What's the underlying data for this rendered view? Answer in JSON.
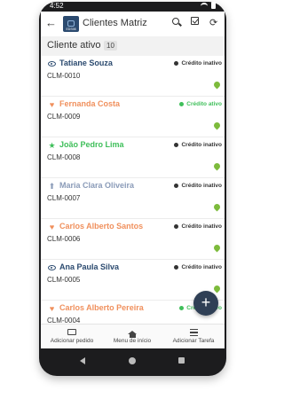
{
  "status_bar": {
    "time": "4:52"
  },
  "app_bar": {
    "logo_text": "EDS98",
    "title": "Clientes Matriz"
  },
  "section": {
    "label": "Cliente ativo",
    "count": "10"
  },
  "clients": [
    {
      "name": "Tatiane Souza",
      "code": "CLM-0010",
      "icon": "eye-icon",
      "name_color": "#2b4a6f",
      "credit": "Crédito inativo",
      "credit_color": "#333333"
    },
    {
      "name": "Fernanda Costa",
      "code": "CLM-0009",
      "icon": "heart-icon",
      "name_color": "#f0905d",
      "credit": "Crédito ativo",
      "credit_color": "#3fbf5a"
    },
    {
      "name": "João Pedro Lima",
      "code": "CLM-0008",
      "icon": "star-icon",
      "name_color": "#3fbf5a",
      "credit": "Crédito inativo",
      "credit_color": "#333333"
    },
    {
      "name": "Maria Clara Oliveira",
      "code": "CLM-0007",
      "icon": "arrow-up-icon",
      "name_color": "#8a9bb8",
      "credit": "Crédito inativo",
      "credit_color": "#333333"
    },
    {
      "name": "Carlos Alberto Santos",
      "code": "CLM-0006",
      "icon": "heart-icon",
      "name_color": "#f0905d",
      "credit": "Crédito inativo",
      "credit_color": "#333333"
    },
    {
      "name": "Ana Paula Silva",
      "code": "CLM-0005",
      "icon": "eye-icon",
      "name_color": "#2b4a6f",
      "credit": "Crédito inativo",
      "credit_color": "#333333"
    },
    {
      "name": "Carlos Alberto Pereira",
      "code": "CLM-0004",
      "icon": "heart-icon",
      "name_color": "#f0905d",
      "credit": "Crédito ativo",
      "credit_color": "#3fbf5a"
    }
  ],
  "bottom_nav": [
    {
      "label": "Adicionar pedido",
      "icon": "folder-add-icon"
    },
    {
      "label": "Menu de início",
      "icon": "home-icon"
    },
    {
      "label": "Adicionar Tarefa",
      "icon": "task-list-icon"
    }
  ],
  "colors": {
    "primary": "#2f3f55",
    "active_green": "#3fbf5a",
    "accent_orange": "#f0905d",
    "pin_green": "#7dbb3c"
  }
}
